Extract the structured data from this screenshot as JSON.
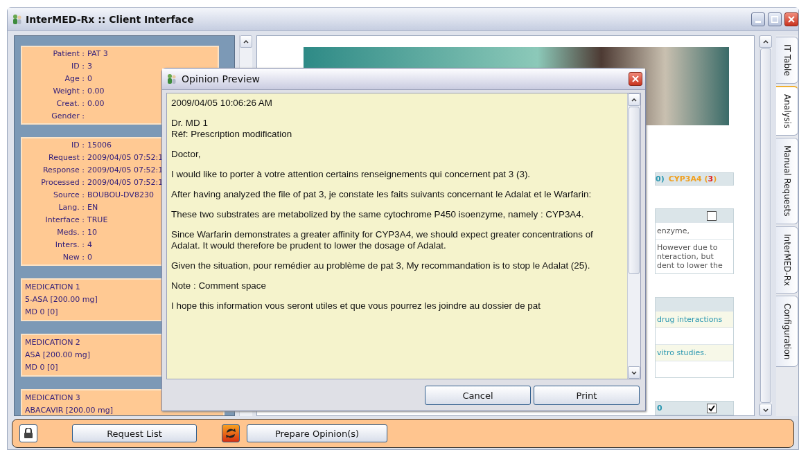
{
  "window": {
    "title": "InterMED-Rx :: Client Interface"
  },
  "patient_card": {
    "fields": [
      {
        "label": "Patient :",
        "value": "PAT 3"
      },
      {
        "label": "ID :",
        "value": "3"
      },
      {
        "label": "Age :",
        "value": "0"
      },
      {
        "label": "Weight :",
        "value": "0.00"
      },
      {
        "label": "Creat. :",
        "value": "0.00"
      },
      {
        "label": "Gender :"
      }
    ]
  },
  "request_card": {
    "fields": [
      {
        "label": "ID :",
        "value": "15006"
      },
      {
        "label": "Request :",
        "value": "2009/04/05 07:52:1"
      },
      {
        "label": "Response :",
        "value": "2009/04/05 07:52:1"
      },
      {
        "label": "Processed :",
        "value": "2009/04/05 07:52:1"
      },
      {
        "label": "Source :",
        "value": "BOUBOU-DV8230"
      },
      {
        "label": "Lang. :",
        "value": "EN"
      },
      {
        "label": "Interface :",
        "value": "TRUE"
      },
      {
        "label": "Meds. :",
        "value": "10"
      },
      {
        "label": "Inters. :",
        "value": "4"
      },
      {
        "label": "New :",
        "value": "0"
      }
    ]
  },
  "medications": [
    {
      "title": "MEDICATION 1",
      "drug": "5-ASA [200.00 mg]",
      "prescriber": "MD 0 [0]"
    },
    {
      "title": "MEDICATION 2",
      "drug": "ASA [200.00 mg]",
      "prescriber": "MD 0 [0]"
    },
    {
      "title": "MEDICATION 3",
      "drug": "ABACAVIR [200.00 mg]"
    }
  ],
  "side_tabs": [
    {
      "label": "IT Table",
      "selected": false
    },
    {
      "label": "Analysis",
      "selected": true
    },
    {
      "label": "Manual Requests",
      "selected": false
    },
    {
      "label": "InterMED-Rx",
      "selected": false
    },
    {
      "label": "Configuration",
      "selected": false
    }
  ],
  "analysis": {
    "summary": [
      {
        "parts": [
          "0)"
        ],
        "kind": "teal"
      },
      {
        "parts": [
          "CYP3A4 (",
          "3",
          ")"
        ],
        "kind": "orange"
      }
    ],
    "tables": [
      {
        "checked": false,
        "rows": [
          {
            "lines": [
              "enzyme,"
            ],
            "highlight": false
          },
          {
            "lines": [
              "However due to",
              "nteraction, but",
              "dent to lower the"
            ],
            "highlight": false
          }
        ]
      },
      {
        "rows": [
          {
            "lines": [
              "drug interactions"
            ],
            "highlight": true
          },
          {
            "highlight": false
          },
          {
            "lines": [
              "vitro studies."
            ],
            "highlight": true
          },
          {
            "highlight": false
          }
        ]
      },
      {
        "header": "0",
        "checked": true
      }
    ]
  },
  "dialog": {
    "title": "Opinion Preview",
    "paragraphs": [
      [
        "2009/04/05 10:06:26 AM"
      ],
      [
        "Dr. MD 1",
        "Réf: Prescription modification"
      ],
      [
        "Doctor,"
      ],
      [
        "I would like to porter à votre attention certains renseignements qui concernent pat 3 (3)."
      ],
      [
        "After having analyzed the file of pat 3, je constate les faits suivants concernant le Adalat et le Warfarin:"
      ],
      [
        "These two substrates are metabolized by the same cytochrome P450 isoenzyme, namely : CYP3A4."
      ],
      [
        "Since Warfarin demonstrates a greater affinity for CYP3A4, we should expect greater concentrations of Adalat.  It would therefore be prudent to lower the dosage of Adalat."
      ],
      [
        "Given the situation, pour remédier au problème de pat 3, My recommandation is to stop le Adalat (25)."
      ],
      [
        "Note : Comment space"
      ],
      [
        "I hope this information vous seront utiles et que vous pourrez les joindre au dossier de pat"
      ]
    ],
    "buttons": [
      "Cancel",
      "Print"
    ]
  },
  "bottom_bar": {
    "request_list": "Request List",
    "prepare": "Prepare Opinion(s)"
  }
}
